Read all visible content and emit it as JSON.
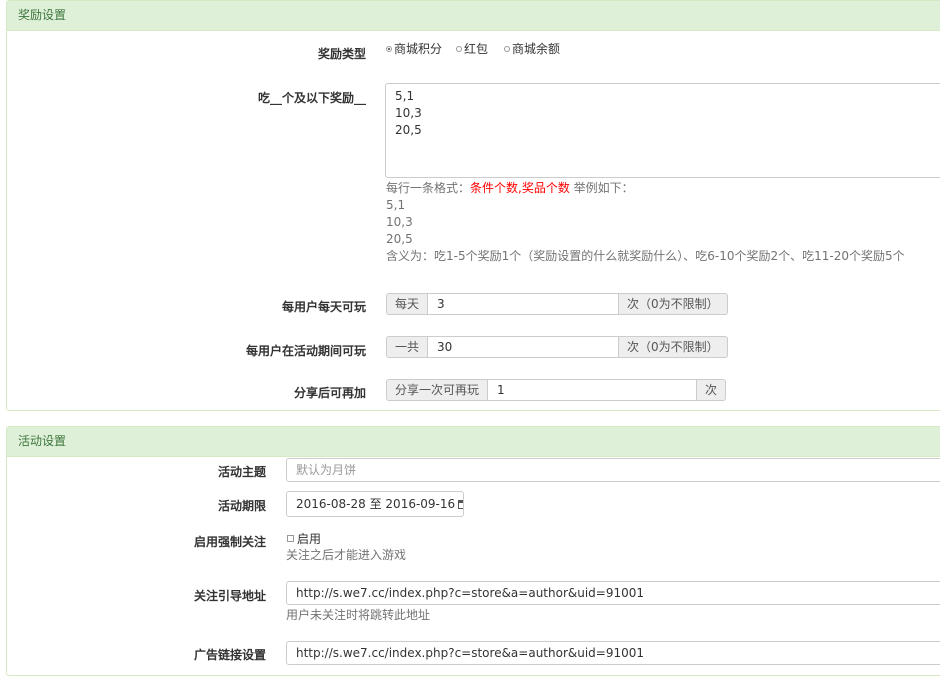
{
  "reward_panel": {
    "title": "奖励设置",
    "reward_type": {
      "label": "奖励类型",
      "options": [
        {
          "label": "商城积分",
          "selected": true
        },
        {
          "label": "红包",
          "selected": false
        },
        {
          "label": "商城余额",
          "selected": false
        }
      ]
    },
    "eat_reward": {
      "label": "吃__个及以下奖励__",
      "value": "5,1\n10,3\n20,5",
      "help_prefix": "每行一条格式：",
      "help_red": "条件个数,奖品个数",
      "help_suffix": " 举例如下：",
      "help_examples": [
        "5,1",
        "10,3",
        "20,5"
      ],
      "help_meaning": "含义为：吃1-5个奖励1个（奖励设置的什么就奖励什么）、吃6-10个奖励2个、吃11-20个奖励5个"
    },
    "daily_limit": {
      "label": "每用户每天可玩",
      "prefix": "每天",
      "value": "3",
      "suffix": "次（0为不限制）"
    },
    "period_limit": {
      "label": "每用户在活动期间可玩",
      "prefix": "一共",
      "value": "30",
      "suffix": "次（0为不限制）"
    },
    "share_extra": {
      "label": "分享后可再加",
      "prefix": "分享一次可再玩",
      "value": "1",
      "suffix": "次"
    }
  },
  "activity_panel": {
    "title": "活动设置",
    "theme": {
      "label": "活动主题",
      "placeholder": "默认为月饼"
    },
    "period": {
      "label": "活动期限",
      "start": "2016-08-28",
      "separator": "至",
      "end": "2016-09-16",
      "icon": "calendar-icon"
    },
    "force_follow": {
      "label": "启用强制关注",
      "checkbox_label": "启用",
      "checked": false,
      "help": "关注之后才能进入游戏"
    },
    "follow_url": {
      "label": "关注引导地址",
      "value": "http://s.we7.cc/index.php?c=store&a=author&uid=91001",
      "help": "用户未关注时将跳转此地址"
    },
    "ad_link": {
      "label": "广告链接设置",
      "value": "http://s.we7.cc/index.php?c=store&a=author&uid=91001"
    }
  }
}
